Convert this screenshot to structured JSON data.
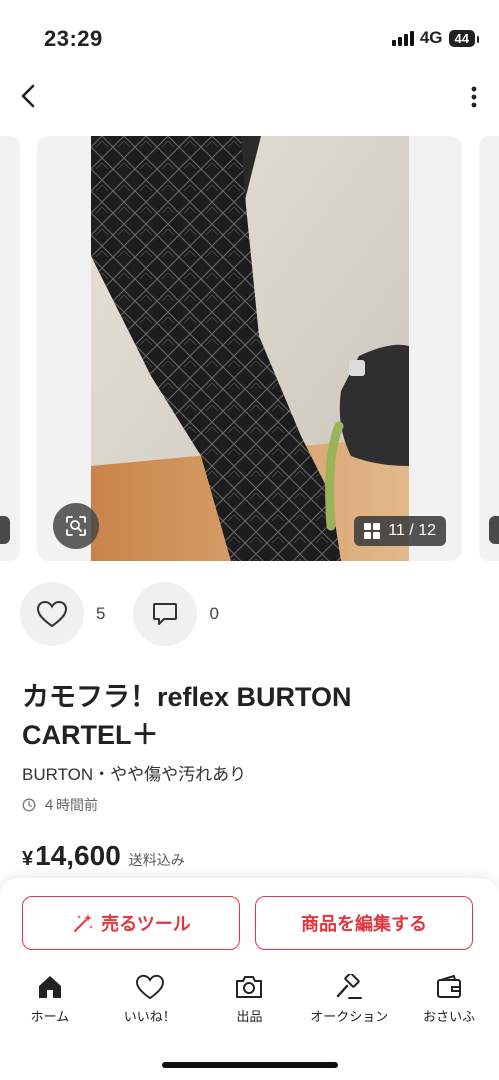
{
  "status": {
    "time": "23:29",
    "network": "4G",
    "battery": "44"
  },
  "gallery": {
    "counter": "11 / 12"
  },
  "engagement": {
    "likes": "5",
    "comments": "0"
  },
  "product": {
    "title": "カモフラ！reflex BURTON CARTEL＋",
    "brand_condition": "BURTON・やや傷や汚れあり",
    "posted": "４時間前",
    "currency": "¥",
    "price": "14,600",
    "shipping": "送料込み"
  },
  "cta": {
    "sell_tool": "売るツール",
    "edit": "商品を編集する"
  },
  "tabs": [
    {
      "label": "ホーム",
      "icon": "home-icon"
    },
    {
      "label": "いいね！",
      "icon": "heart-icon"
    },
    {
      "label": "出品",
      "icon": "camera-icon"
    },
    {
      "label": "オークション",
      "icon": "gavel-icon"
    },
    {
      "label": "おさいふ",
      "icon": "wallet-icon"
    }
  ],
  "colors": {
    "accent": "#e2373f",
    "text": "#222222"
  }
}
